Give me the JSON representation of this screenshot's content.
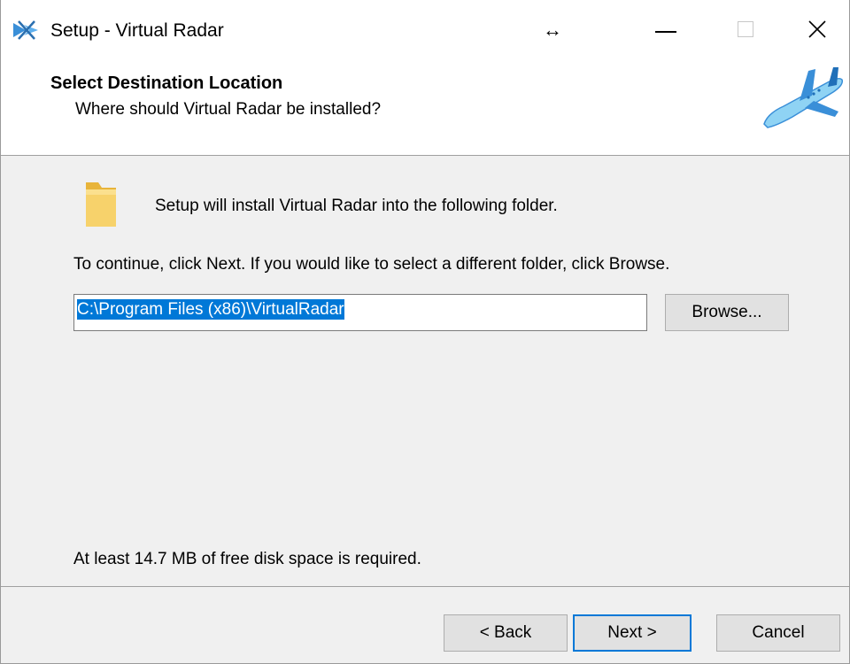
{
  "window": {
    "title": "Setup - Virtual Radar",
    "app_icon": "virtual-radar-app-icon",
    "resize_icon": "↔",
    "controls": {
      "minimize": "minimize-icon",
      "maximize": "maximize-icon",
      "close": "×"
    }
  },
  "header": {
    "title": "Select Destination Location",
    "subtitle": "Where should Virtual Radar be installed?",
    "image": "airplane-icon"
  },
  "content": {
    "intro": "Setup will install Virtual Radar into the following folder.",
    "instructions": "To continue, click Next. If you would like to select a different folder, click Browse.",
    "path_value": "C:\\Program Files (x86)\\VirtualRadar",
    "browse_label": "Browse...",
    "disk_space": "At least 14.7 MB of free disk space is required."
  },
  "footer": {
    "back_label": "< Back",
    "next_label": "Next >",
    "cancel_label": "Cancel"
  },
  "colors": {
    "accent": "#0078d7",
    "button_face": "#e1e1e1",
    "dialog_bg": "#f0f0f0",
    "folder": "#f3c95a"
  }
}
